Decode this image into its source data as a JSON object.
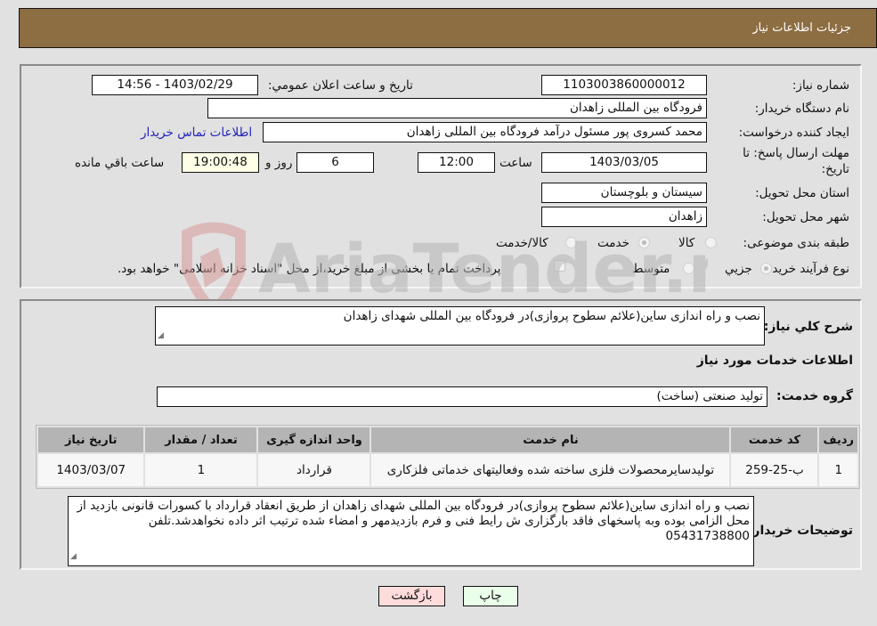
{
  "header": {
    "title": "جزئیات اطلاعات نیاز"
  },
  "form": {
    "need_number": {
      "label": "شماره نیاز:",
      "value": "1103003860000012"
    },
    "announce_datetime": {
      "label": "تاریخ و ساعت اعلان عمومي:",
      "value": "1403/02/29 - 14:56"
    },
    "buyer_org": {
      "label": "نام دستگاه خریدار:",
      "value": "فرودگاه بین المللی زاهدان"
    },
    "requester": {
      "label": "ایجاد کننده درخواست:",
      "value": "محمد کسروی پور مسئول درآمد فرودگاه بین المللی زاهدان",
      "contact_link": "اطلاعات تماس خریدار"
    },
    "deadline": {
      "label_line1": "مهلت ارسال پاسخ: تا",
      "label_line2": "تاریخ:",
      "date": "1403/03/05",
      "time_label": "ساعت",
      "time": "12:00",
      "days": "6",
      "days_label": "روز و",
      "remaining": "19:00:48",
      "remaining_label": "ساعت باقي مانده"
    },
    "province": {
      "label": "استان محل تحویل:",
      "value": "سیستان و بلوچستان"
    },
    "city": {
      "label": "شهر محل تحویل:",
      "value": "زاهدان"
    },
    "category": {
      "label": "طبقه بندی موضوعی:",
      "options": [
        "کالا",
        "خدمت",
        "کالا/خدمت"
      ],
      "selected": "خدمت"
    },
    "purchase_type": {
      "label": "نوع فرآیند خرید :",
      "options": [
        "جزيي",
        "متوسط"
      ],
      "selected": "جزيي",
      "treasury_note": "پرداخت تمام یا بخشی از مبلغ خرید،از محل \"اسناد خزانه اسلامی\" خواهد بود."
    }
  },
  "details": {
    "summary_label": "شرح كلي نياز:",
    "summary": "نصب و راه اندازی ساین(علائم سطوح پروازی)در فرودگاه بین المللی شهدای زاهدان",
    "services_title": "اطلاعات خدمات مورد نیاز",
    "service_group_label": "گروه خدمت:",
    "service_group": "تولید صنعتی (ساخت)",
    "table": {
      "headers": [
        "ردیف",
        "کد خدمت",
        "نام خدمت",
        "واحد اندازه گیری",
        "تعداد / مقدار",
        "تاریخ نیاز"
      ],
      "rows": [
        [
          "1",
          "ب-25-259",
          "تولیدسایرمحصولات فلزی ساخته شده وفعالیتهای خدماتی فلزکاری",
          "قرارداد",
          "1",
          "1403/03/07"
        ]
      ]
    },
    "buyer_notes_label": "توضیحات خریدار:",
    "buyer_notes": "نصب و راه اندازی ساین(علائم سطوح پروازی)در فرودگاه بین المللی شهدای زاهدان از طریق انعقاد قرارداد با کسورات قانونی بازدید از محل الزامی بوده وبه پاسخهای فاقد بارگزاری ش رایط فنی و فرم بازدیدمهر و امضاء شده ترتیب اثر داده نخواهدشد.تلفن 05431738800"
  },
  "buttons": {
    "print": "چاپ",
    "back": "بازگشت"
  },
  "colors": {
    "header_bg": "#8d6d42",
    "print_bg": "#eaffea",
    "back_bg": "#ffdcdc",
    "remaining_bg": "#ffffe8",
    "link": "#2222bb"
  },
  "watermark": {
    "text": "AriaTender.neT"
  }
}
